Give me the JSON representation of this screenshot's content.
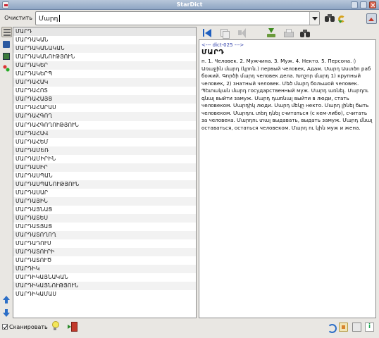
{
  "window": {
    "title": "StarDict"
  },
  "toolbar": {
    "clear_label": "Очистить",
    "search_value": "Մարդ"
  },
  "wordlist": {
    "items": [
      "ՄԱՐԴ",
      "ՄԱՐԴԱԿԱՆ",
      "ՄԱՐԴԱԿԱՆԱԿԱՆ",
      "ՄԱՐԴԱԿԱՆՈՒԹՅՈՒՆ",
      "ՄԱՐԴԱԿԵՐ",
      "ՄԱՐԴԱԿԵՐՊ",
      "ՄԱՐԴԱՀԱԿ",
      "ՄԱՐԴԱՀՈՏ",
      "ՄԱՐԴԱՀԱՅՑ",
      "ՄԱՐԴԱՀԱՐԱՍ",
      "ՄԱՐԴԱՀԳՈՂ",
      "ՄԱՐԴԱՀԳՈՂՈՒԹՅՈՒՆ",
      "ՄԱՐԴԱՀԱՎ",
      "ՄԱՐԴԱՀԵՄ",
      "ՄԱՐԴԱՄԵՌ",
      "ՄԱՐԴԱՄԻՐԻՆ",
      "ՄԱՐԴԱՍԻՐ",
      "ՄԱՐԴԱՍՊԱՆ",
      "ՄԱՐԴԱՍՊԱՆՈՒԹՅՈՒՆ",
      "ՄԱՐԴԱՍԱՐ",
      "ՄԱՐԴԱՅԻՆ",
      "ՄԱՐԴԱՅՆԱՑ",
      "ՄԱՐԴԱՏԵՍ",
      "ՄԱՐԴԱՏՅԱՑ",
      "ՄԱՐԴԱՏՈՂՈՂ",
      "ՄԱՐԴԱԴՈՒՍ",
      "ՄԱՐԴԱՏՈՒՐԻ",
      "ՄԱՐԴԱՏՈՒԾ",
      "ՄԱՐԴԻԿ",
      "ՄԱՐԴԻԿԱՅՆԱԿԱՆ",
      "ՄԱՐԴԻԿԱՅՆՈՒԹՅՈՒՆ",
      "ՄԱՐԴԻԿԱՄԱՍ"
    ],
    "selected_index": 0
  },
  "definition": {
    "dict_marker": "<--- dict-025 --->",
    "headword": "ՄԱՐԴ",
    "body": "п. 1. Человек. 2. Мужчина. 3. Муж. 4. Некто. 5. Персона. ◊ Առաջին մարդ (կրոն.) первый человек, Адам. Մարդ Աստծո раб божий. Գործի մարդ человек дела. Խոշոր մարդ 1) крупный человек, 2) знатный человек. Մեծ մարդ большой человек. Պետական մարդ государственный муж. Մարդ առնել. Մարդու գնալ выйти замуж. Մարդ դառնալ выйти в люди, стать человеком. Մարդիկ люди. Մարդ մեկը некто. Մարդ լինել быть человеком. Մարդու տեղ դնել считаться (с кем-либо), считать за человека. Մարդու տալ выдавать, выдать замуж. Մարդ մնալ оставаться, остаться человеком. Մարդ ու կին муж и жена."
  },
  "bottom": {
    "scan_label": "Сканировать",
    "scan_checked": true
  },
  "icons": {
    "clear": "clear-button",
    "search": "binoculars-icon",
    "pronounce": "pronounce-icon",
    "menu": "main-menu-icon",
    "side": [
      "word-list-icon",
      "dict-icon",
      "dict-manage-icon",
      "tree-icon",
      "scroll-up-icon",
      "scroll-down-icon"
    ],
    "def_toolbar": [
      "back-icon",
      "copy-icon",
      "speak-icon",
      "save-icon",
      "print-icon",
      "search-in-def-icon"
    ],
    "bottom_right": [
      "refresh-icon",
      "dict-manager-icon",
      "preferences-icon",
      "about-icon"
    ]
  },
  "colors": {
    "dict_marker": "#2a3aa8",
    "title_bar": "#8ea5c3"
  }
}
